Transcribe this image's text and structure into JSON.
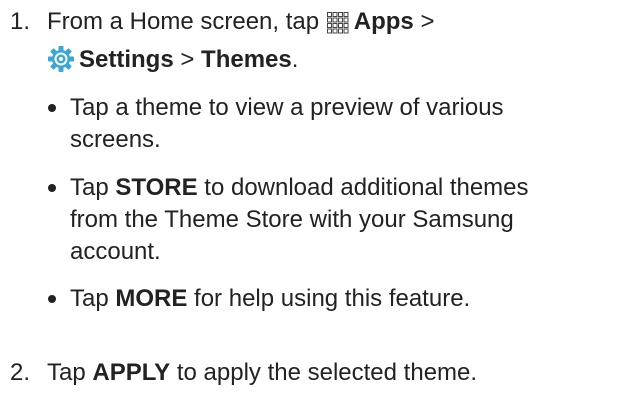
{
  "colors": {
    "text": "#222222",
    "settings_icon": "#3aa7d6"
  },
  "steps": [
    {
      "number": "1.",
      "line1": {
        "pre": "From a Home screen, tap",
        "icon": "apps-grid-icon",
        "bold": "Apps",
        "post": " >"
      },
      "line2": {
        "icon": "settings-gear-icon",
        "bold1": "Settings",
        "mid": " > ",
        "bold2": "Themes",
        "post": "."
      }
    },
    {
      "number": "2.",
      "pre": "Tap ",
      "bold": "APPLY",
      "post": " to apply the selected theme."
    }
  ],
  "bullets": [
    {
      "lines": [
        "Tap a theme to view a preview of various",
        "screens."
      ]
    },
    {
      "pre": "Tap ",
      "bold": "STORE",
      "post": " to download additional themes",
      "lines": [
        "from the Theme Store with your Samsung",
        "account."
      ]
    },
    {
      "pre": "Tap ",
      "bold": "MORE",
      "post": " for help using this feature."
    }
  ]
}
